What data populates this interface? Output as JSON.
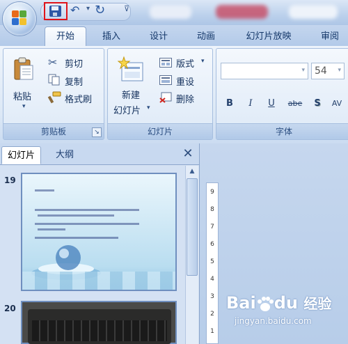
{
  "tabs": [
    "开始",
    "插入",
    "设计",
    "动画",
    "幻灯片放映",
    "审阅"
  ],
  "clipboard": {
    "paste": "粘贴",
    "cut": "剪切",
    "copy": "复制",
    "format_painter": "格式刷",
    "group_label": "剪贴板"
  },
  "slides_group": {
    "new_slide_line1": "新建",
    "new_slide_line2": "幻灯片",
    "layout": "版式",
    "reset": "重设",
    "delete": "删除",
    "group_label": "幻灯片"
  },
  "font_group": {
    "font_size": "54",
    "group_label": "字体",
    "buttons": [
      "B",
      "I",
      "U",
      "abe",
      "S",
      "AV"
    ]
  },
  "slides_pane": {
    "tab_slides": "幻灯片",
    "tab_outline": "大纲",
    "close": "✕",
    "slide_numbers": [
      "19",
      "20"
    ]
  },
  "ruler_ticks": [
    "1",
    "2",
    "3",
    "4",
    "5",
    "6",
    "7",
    "8",
    "9"
  ],
  "watermark": {
    "brand": "Bai",
    "brand_tail": "du",
    "suffix": "经验",
    "url": "jingyan.baidu.com"
  },
  "colors": {
    "save_highlight": "#e0141b",
    "ribbon_blue": "#dce8f6"
  }
}
